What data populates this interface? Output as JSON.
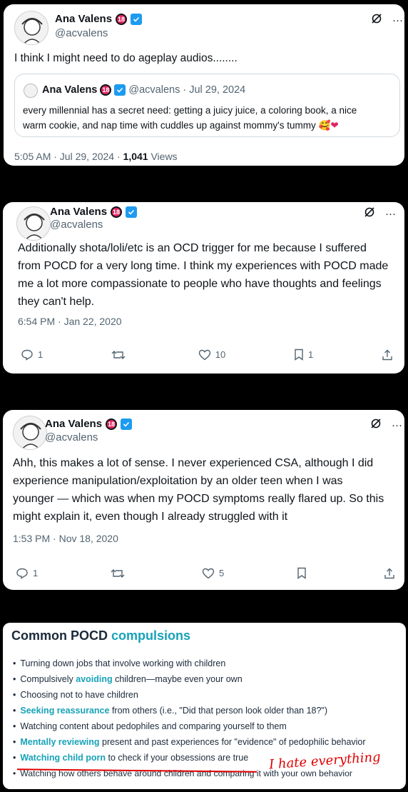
{
  "tweet1": {
    "name": "Ana Valens",
    "badge": "18",
    "handle": "@acvalens",
    "text": "I think I might need to do ageplay audios........",
    "quote": {
      "name": "Ana Valens",
      "badge": "18",
      "handle_date": "@acvalens · Jul 29, 2024",
      "text_line1": "every millennial has a secret need: getting a juicy juice, a coloring book, a nice",
      "text_line2": "warm cookie, and nap time with cuddles up against mommy's tummy",
      "emoji": "🥰❤"
    },
    "time": "5:05 AM · Jul 29, 2024 · ",
    "views_count": "1,041",
    "views_label": " Views"
  },
  "tweet2": {
    "name": "Ana Valens",
    "badge": "18",
    "handle": "@acvalens",
    "text_lines": [
      "Additionally shota/loli/etc is an OCD trigger for me because I suffered",
      "from POCD for a very long time. I think my experiences with POCD made",
      "me a lot more compassionate to people who have thoughts and feelings",
      "they can't help."
    ],
    "time": "6:54 PM · Jan 22, 2020",
    "replies": "1",
    "retweets": "",
    "likes": "10",
    "bookmarks": "1"
  },
  "tweet3": {
    "name": "Ana Valens",
    "badge": "18",
    "handle": "@acvalens",
    "text_lines": [
      "Ahh, this makes a lot of sense. I never experienced CSA, although I did",
      "experience manipulation/exploitation by an older teen when I was",
      "younger — which was when my POCD symptoms really flared up. So this",
      "might explain it, even though I already struggled with it"
    ],
    "time": "1:53 PM · Nov 18, 2020",
    "replies": "1",
    "retweets": "",
    "likes": "5",
    "bookmarks": ""
  },
  "infographic": {
    "title_plain": "Common POCD ",
    "title_accent": "compulsions",
    "items": [
      {
        "pre": "Turning down jobs that involve working with children",
        "accent": "",
        "post": ""
      },
      {
        "pre": "Compulsively ",
        "accent": "avoiding",
        "post": " children—maybe even your own"
      },
      {
        "pre": "Choosing not to have children",
        "accent": "",
        "post": ""
      },
      {
        "pre": "",
        "accent": "Seeking reassurance",
        "post": " from others (i.e., \"Did that person look older than 18?\")"
      },
      {
        "pre": "Watching content about pedophiles and comparing yourself to them",
        "accent": "",
        "post": ""
      },
      {
        "pre": "",
        "accent": "Mentally reviewing",
        "post": " present and past experiences for \"evidence\" of pedophilic behavior"
      },
      {
        "pre": "",
        "accent": "Watching child porn",
        "post": " to check if your obsessions are true"
      },
      {
        "pre": "Watching how others behave around children and comparing it with your own behavior",
        "accent": "",
        "post": ""
      }
    ],
    "handwritten_note": "I hate everything"
  },
  "colors": {
    "accent": "#17a2b8",
    "verified": "#1d9bf0",
    "badge": "#e0245e",
    "annotation": "#e00000"
  }
}
